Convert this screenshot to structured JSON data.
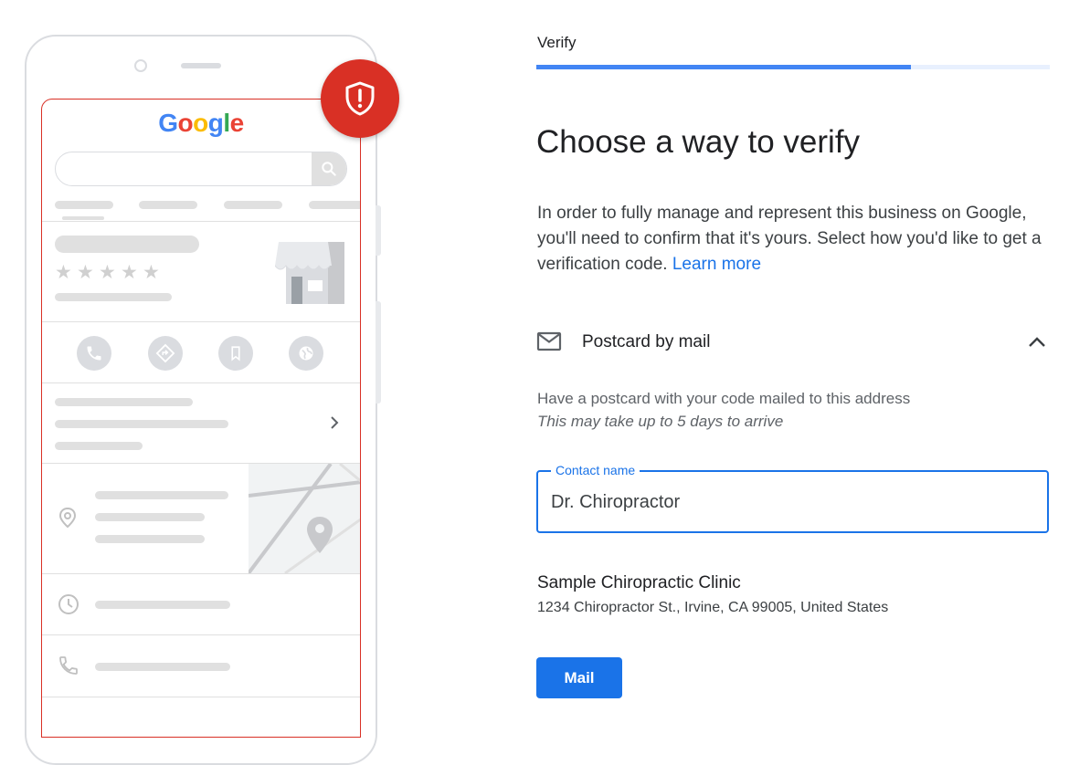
{
  "illustration": {
    "logo_text": "Google",
    "stars": [
      "★",
      "★",
      "★",
      "★",
      "★"
    ],
    "action_icons": [
      "phone-icon",
      "directions-icon",
      "bookmark-icon",
      "globe-icon"
    ],
    "alert_icon": "shield-alert-icon"
  },
  "header": {
    "step_label": "Verify",
    "progress": 0.73
  },
  "main": {
    "title": "Choose a way to verify",
    "description": "In order to fully manage and represent this business on Google, you'll need to confirm that it's yours. Select how you'd like to get a verification code.",
    "learn_more": "Learn more"
  },
  "option": {
    "icon": "mail-icon",
    "label": "Postcard by mail",
    "expanded": true,
    "description": "Have a postcard with your code mailed to this address",
    "note": "This may take up to 5 days to arrive"
  },
  "form": {
    "contact_label": "Contact name",
    "contact_value": "Dr. Chiropractor"
  },
  "business": {
    "name": "Sample Chiropractic Clinic",
    "address": "1234 Chiropractor St., Irvine, CA 99005, United States"
  },
  "actions": {
    "mail_button": "Mail"
  },
  "colors": {
    "accent": "#1a73e8",
    "progress": "#4285f4",
    "alert": "#d93025"
  }
}
